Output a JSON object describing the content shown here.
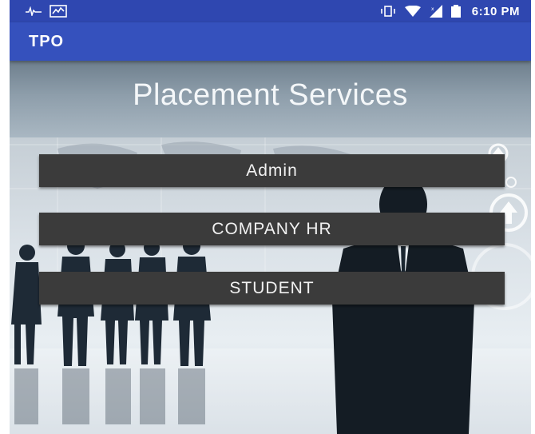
{
  "status_bar": {
    "time": "6:10 PM",
    "icons": [
      "pulse-notification-icon",
      "activity-chart-icon",
      "vibrate-icon",
      "wifi-icon",
      "cellular-signal-icon",
      "battery-icon"
    ]
  },
  "app_bar": {
    "title": "TPO"
  },
  "screen": {
    "title": "Placement Services"
  },
  "buttons": {
    "admin": "Admin",
    "company_hr": "COMPANY HR",
    "student": "STUDENT"
  },
  "colors": {
    "status_bar": "#2f47b0",
    "app_bar": "#3551bd",
    "button_bg": "#3b3b3b",
    "button_text": "#f1f1f1"
  }
}
